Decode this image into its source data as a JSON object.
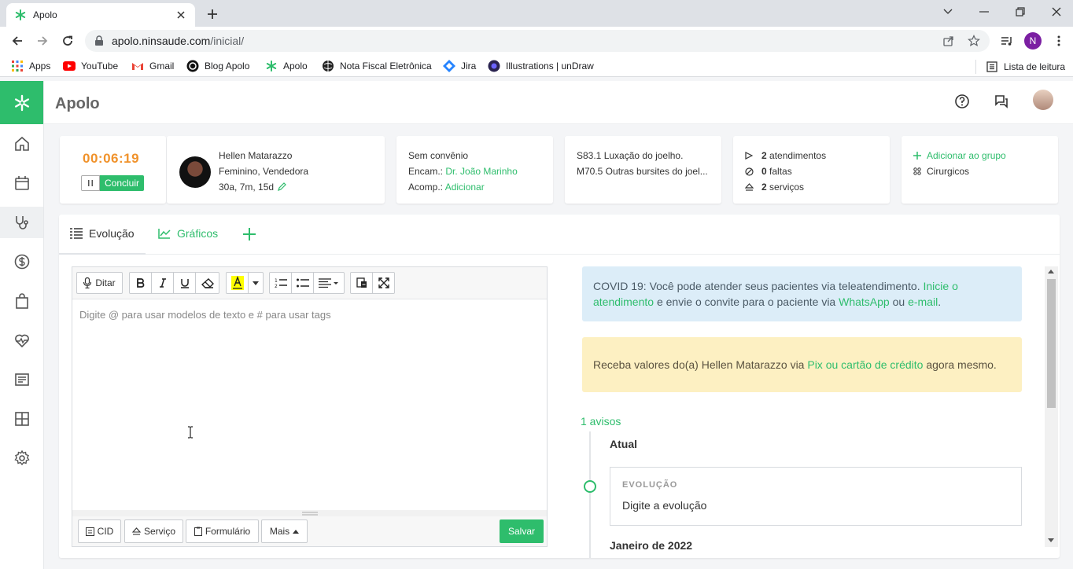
{
  "browser": {
    "tab_title": "Apolo",
    "url_host": "apolo.ninsaude.com",
    "url_path": "/inicial/",
    "profile_initial": "N",
    "bookmarks": [
      {
        "label": "Apps",
        "icon": "apps-grid-icon"
      },
      {
        "label": "YouTube",
        "icon": "youtube-icon"
      },
      {
        "label": "Gmail",
        "icon": "gmail-icon"
      },
      {
        "label": "Blog Apolo",
        "icon": "blog-icon"
      },
      {
        "label": "Apolo",
        "icon": "apolo-icon"
      },
      {
        "label": "Nota Fiscal Eletrônica",
        "icon": "globe-icon"
      },
      {
        "label": "Jira",
        "icon": "jira-icon"
      },
      {
        "label": "Illustrations | unDraw",
        "icon": "undraw-icon"
      }
    ],
    "reading_list": "Lista de leitura"
  },
  "app": {
    "title": "Apolo",
    "accent": "#2ebd6c"
  },
  "session": {
    "timer": "00:06:19",
    "finish_label": "Concluir"
  },
  "patient": {
    "name": "Hellen Matarazzo",
    "details": "Feminino, Vendedora",
    "age": "30a, 7m, 15d"
  },
  "insurance": {
    "plan": "Sem convênio",
    "referral_label": "Encam.:",
    "referral_doctor": "Dr. João Marinho",
    "companion_label": "Acomp.:",
    "companion_action": "Adicionar"
  },
  "diagnoses": {
    "line1": "S83.1 Luxação do joelho.",
    "line2": "M70.5 Outras bursites do joel..."
  },
  "stats": {
    "appointments_count": "2",
    "appointments_label": "atendimentos",
    "absences_count": "0",
    "absences_label": "faltas",
    "services_count": "2",
    "services_label": "serviços"
  },
  "groups": {
    "add_label": "Adicionar ao grupo",
    "group_name": "Cirurgicos"
  },
  "tabs": {
    "evolution": "Evolução",
    "charts": "Gráficos"
  },
  "editor": {
    "dictate_label": "Ditar",
    "placeholder": "Digite @ para usar modelos de texto e # para usar tags",
    "footer": {
      "cid": "CID",
      "service": "Serviço",
      "form": "Formulário",
      "more": "Mais",
      "save": "Salvar"
    }
  },
  "alerts": {
    "covid_text1": "COVID 19: Você pode atender seus pacientes via teleatendimento. ",
    "covid_link1": "Inicie o atendimento",
    "covid_text2": " e envie o convite para o paciente via ",
    "covid_link2": "WhatsApp",
    "covid_text3": " ou ",
    "covid_link3": "e-mail",
    "covid_text4": ".",
    "pix_text1": "Receba valores do(a) Hellen Matarazzo via ",
    "pix_link": "Pix ou cartão de crédito",
    "pix_text2": " agora mesmo."
  },
  "timeline": {
    "notices": "1 avisos",
    "current_label": "Atual",
    "card_label": "EVOLUÇÃO",
    "card_text": "Digite a evolução",
    "next_label": "Janeiro de 2022"
  }
}
